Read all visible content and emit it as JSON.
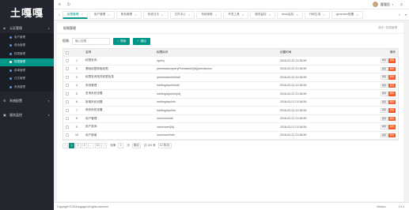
{
  "app": {
    "logo": "土嘎嘎"
  },
  "sidebar": {
    "groups": [
      {
        "label": "认证管理",
        "icon": "shield-icon",
        "items": [
          {
            "label": "用户管理",
            "active": false
          },
          {
            "label": "角色管理",
            "active": false
          },
          {
            "label": "权限管理",
            "active": false
          },
          {
            "label": "权限管理",
            "active": true
          },
          {
            "label": "菜单管理",
            "active": false
          },
          {
            "label": "日志管理",
            "active": false
          },
          {
            "label": "系统管理",
            "active": false
          }
        ]
      },
      {
        "label": "系统配置",
        "icon": "gear-icon",
        "items": []
      },
      {
        "label": "服务监控",
        "icon": "monitor-icon",
        "items": []
      }
    ]
  },
  "header": {
    "user": "管理员"
  },
  "tabs": [
    {
      "label": "权限管理",
      "active": true
    },
    {
      "label": "用户管理",
      "active": false
    },
    {
      "label": "角色管理",
      "active": false
    },
    {
      "label": "系统日志",
      "active": false
    },
    {
      "label": "文件中心",
      "active": false
    },
    {
      "label": "系统参数",
      "active": false
    },
    {
      "label": "开发工具",
      "active": false
    },
    {
      "label": "服务监控",
      "active": false
    },
    {
      "label": "druid监控",
      "active": false
    },
    {
      "label": "代码生成",
      "active": false
    },
    {
      "label": "generator配置",
      "active": false
    }
  ],
  "panel": {
    "title": "权限管理",
    "breadcrumb": "首页 / 权限管理",
    "search_label": "权限:",
    "search_placeholder": "输入权限",
    "search_button": "搜索",
    "add_button": "增加"
  },
  "table": {
    "columns": [
      "名称",
      "权限标识",
      "创建时间",
      "操作"
    ],
    "rows": [
      {
        "num": "1",
        "name": "权限查询",
        "url": "/query",
        "time": "2018-03-21 21:38:59"
      },
      {
        "num": "2",
        "name": "基础权限获取权限",
        "url": "permission/queryPermission/{id}/permission",
        "time": "2018-03-21 21:38:59"
      },
      {
        "num": "3",
        "name": "权限查询相关权限信息",
        "url": "/permission/info/all",
        "time": "2018-03-21 21:38:59"
      },
      {
        "num": "4",
        "name": "系统管理",
        "url": "/setting/sysInfo/all",
        "time": "2018-03-21 21:38:59"
      },
      {
        "num": "5",
        "name": "查询系统设置",
        "url": "/setting/sysInfo/{id}",
        "time": "2018-03-21 21:38:59"
      },
      {
        "num": "6",
        "name": "新增系统设置",
        "url": "/setting/sysInfo",
        "time": "2018-03-21 21:38:59"
      },
      {
        "num": "7",
        "name": "修改系统设置",
        "url": "/setting/sysInfo",
        "time": "2018-03-21 21:38:59"
      },
      {
        "num": "8",
        "name": "用户管理",
        "url": "/user/user/all",
        "time": "2018-03-21 21:38:59"
      },
      {
        "num": "9",
        "name": "用户查询",
        "url": "/user/user/{id}",
        "time": "2018-03-21 21:38:59"
      },
      {
        "num": "10",
        "name": "用户新增",
        "url": "/user/user/info",
        "time": "2018-03-21 21:38:59"
      }
    ],
    "edit_label": "编辑",
    "delete_label": "删除"
  },
  "pager": {
    "pages": [
      "1",
      "2",
      "3",
      "…",
      "10"
    ],
    "active_page": "1",
    "goto_label": "到第",
    "goto_value": "1",
    "page_suffix": "页",
    "confirm": "确定",
    "total": "共 100 条",
    "per_page": "10 条/页"
  },
  "footer": {
    "copyright": "Copyright ©2018 tugaga All rights reserved.",
    "version_label": "Version",
    "version": "1.0.0"
  }
}
